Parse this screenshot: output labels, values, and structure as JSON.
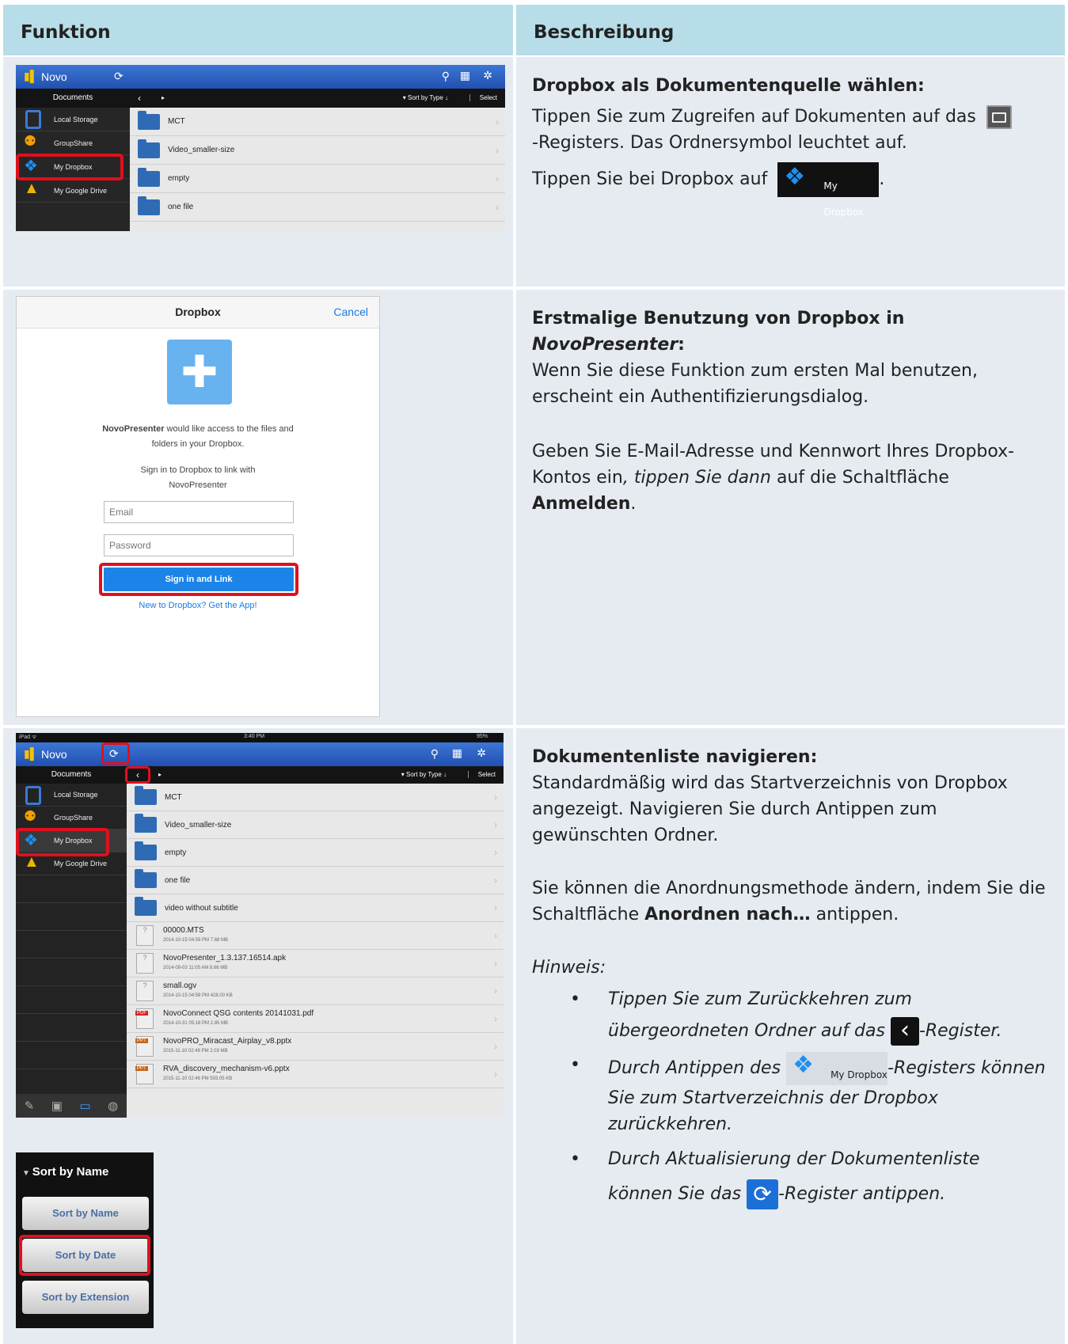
{
  "header": {
    "col1": "Funktion",
    "col2": "Beschreibung"
  },
  "app1": {
    "title": "Novo",
    "documents": "Documents",
    "sort": "▾ Sort by Type ↓",
    "select": "Select",
    "sidebar": [
      "Local Storage",
      "GroupShare",
      "My Dropbox",
      "My Google Drive"
    ],
    "folders": [
      "MCT",
      "Video_smaller-size",
      "empty",
      "one file"
    ]
  },
  "row1": {
    "heading": "Dropbox als Dokumentenquelle wählen:",
    "text1a": "Tippen Sie zum Zugreifen auf Dokumenten auf das",
    "text1b": "-Registers. Das Ordnersymbol leuchtet auf.",
    "text2": "Tippen Sie bei Dropbox auf",
    "text2end": ".",
    "badge": "My Dropbox"
  },
  "dialog": {
    "title": "Dropbox",
    "cancel": "Cancel",
    "app_name": "NovoPresenter",
    "access_text": " would like access to the files and folders in your Dropbox.",
    "sign_text": "Sign in to Dropbox to link with NovoPresenter",
    "email_placeholder": "Email",
    "password_placeholder": "Password",
    "button": "Sign in and Link",
    "link": "New to Dropbox? Get the App!"
  },
  "row2": {
    "heading_a": "Erstmalige Benutzung von Dropbox in ",
    "heading_b": "NovoPresenter",
    "heading_c": ":",
    "p1": "Wenn Sie diese Funktion zum ersten Mal benutzen, erscheint ein Authentifizierungsdialog.",
    "p2a": "Geben Sie E-Mail-Adresse und Kennwort Ihres Dropbox-Kontos ein",
    "p2b": ", tippen Sie dann",
    "p2c": " auf die Schaltfläche ",
    "p2d": "Anmelden",
    "p2e": "."
  },
  "app3": {
    "status_left": "iPad ᯤ",
    "status_time": "3:40 PM",
    "status_right": "95%",
    "title": "Novo",
    "documents": "Documents",
    "sort": "▾ Sort by Type ↓",
    "select": "Select",
    "sidebar": [
      "Local Storage",
      "GroupShare",
      "My Dropbox",
      "My Google Drive"
    ],
    "folders": [
      "MCT",
      "Video_smaller-size",
      "empty",
      "one file",
      "video without subtitle"
    ],
    "files": [
      {
        "name": "00000.MTS",
        "meta": "2014-10-15 04:59 PM   7.68 MB",
        "type": "unknown"
      },
      {
        "name": "NovoPresenter_1.3.137.16514.apk",
        "meta": "2014-09-03 11:05 AM   8.66 MB",
        "type": "unknown"
      },
      {
        "name": "small.ogv",
        "meta": "2014-10-15 04:59 PM   428.00 KB",
        "type": "unknown"
      },
      {
        "name": "NovoConnect QSG contents 20141031.pdf",
        "meta": "2014-10-31 05:18 PM   2.85 MB",
        "type": "PDF"
      },
      {
        "name": "NovoPRO_Miracast_Airplay_v8.pptx",
        "meta": "2015-11-10 02:48 PM   2.03 MB",
        "type": "PPT"
      },
      {
        "name": "RVA_discovery_mechanism-v6.pptx",
        "meta": "2015-11-10 02:46 PM   593.05 KB",
        "type": "PPT"
      }
    ]
  },
  "sortmenu": {
    "header": "Sort by Name",
    "options": [
      "Sort by Name",
      "Sort by Date",
      "Sort by Extension"
    ]
  },
  "row3": {
    "heading": "Dokumentenliste navigieren:",
    "p1": "Standardmäßig wird das Startverzeichnis von Dropbox angezeigt. Navigieren Sie durch Antippen zum gewünschten Ordner.",
    "p2a": "Sie können die Anordnungsmethode ändern, indem Sie die Schaltfläche ",
    "p2b": "Anordnen nach…",
    "p2c": " antippen.",
    "note": "Hinweis:",
    "b1a": "Tippen Sie zum Zurückkehren zum übergeordneten Ordner auf das",
    "b1b": "-Register.",
    "b2a": "Durch Antippen des",
    "b2b": "-Registers können Sie zum Startverzeichnis der Dropbox zurückkehren.",
    "b3a": "Durch Aktualisierung der Dokumentenliste können Sie das",
    "b3b": "-Register antippen.",
    "badge": "My Dropbox"
  }
}
